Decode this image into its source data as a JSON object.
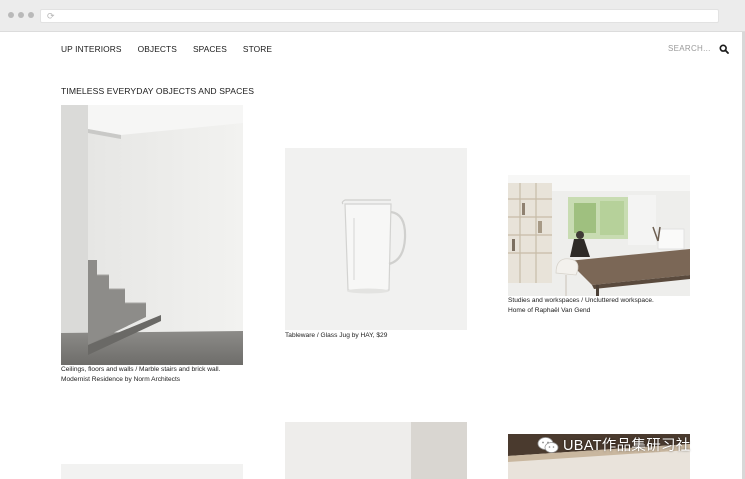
{
  "browser": {
    "reload_glyph": "⟳"
  },
  "nav": {
    "items": [
      "UP INTERIORS",
      "OBJECTS",
      "SPACES",
      "STORE"
    ],
    "search_placeholder": "SEARCH..."
  },
  "headline": "TIMELESS EVERYDAY OBJECTS AND SPACES",
  "gallery": {
    "items": [
      {
        "caption_line1": "Ceilings, floors and walls / Marble stairs and brick wall.",
        "caption_line2": "Modernist Residence by Norm Architects"
      },
      {
        "caption_line1": "Tableware / Glass Jug by HAY, $29"
      },
      {
        "caption_line1": "Studies and workspaces / Uncluttered workspace.",
        "caption_line2": "Home of Raphaël Van Gend"
      }
    ]
  },
  "watermark": {
    "text": "UBAT作品集研习社"
  },
  "icons": {
    "search": "search-icon",
    "reload": "reload-icon",
    "wechat": "wechat-icon"
  },
  "colors": {
    "text": "#1b1b1b",
    "muted": "#9a9a9a",
    "chrome": "#ececec"
  }
}
